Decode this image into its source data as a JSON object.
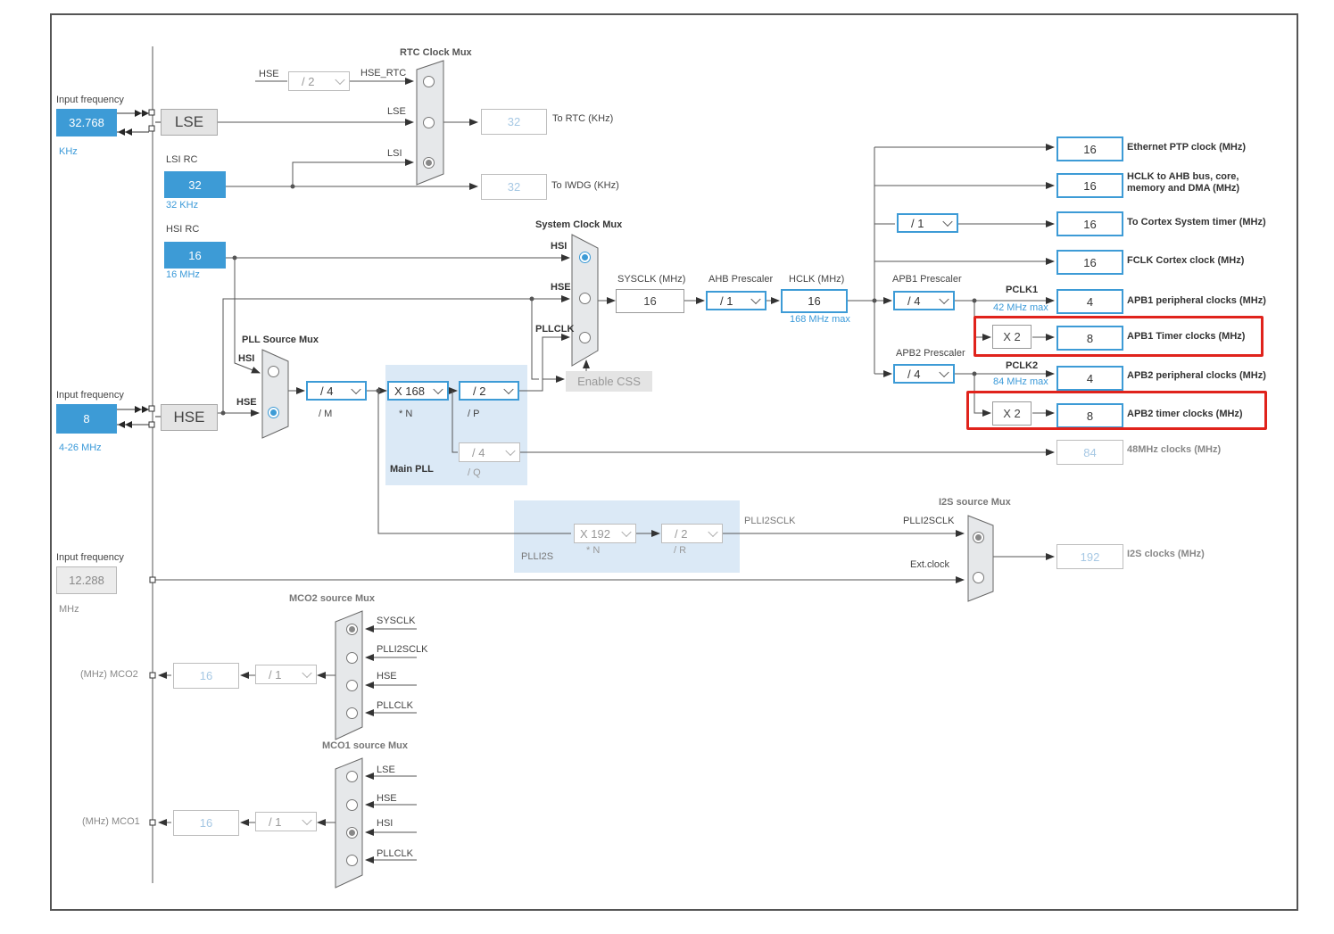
{
  "lse": {
    "input_label": "Input frequency",
    "value": "32.768",
    "unit": "KHz",
    "name": "LSE"
  },
  "lsi": {
    "label": "LSI RC",
    "value": "32",
    "unit": "32 KHz"
  },
  "hsi": {
    "label": "HSI RC",
    "value": "16",
    "unit": "16 MHz"
  },
  "hse": {
    "input_label": "Input frequency",
    "value": "8",
    "unit": "4-26 MHz",
    "name": "HSE"
  },
  "ext": {
    "input_label": "Input frequency",
    "value": "12.288",
    "unit": "MHz"
  },
  "rtc": {
    "mux_title": "RTC Clock Mux",
    "hse_label": "HSE",
    "div": "/ 2",
    "hse_rtc": "HSE_RTC",
    "lse": "LSE",
    "lsi": "LSI",
    "out_value": "32",
    "out_label": "To RTC (KHz)",
    "iwdg_value": "32",
    "iwdg_label": "To IWDG (KHz)"
  },
  "sysmux": {
    "title": "System Clock Mux",
    "hsi": "HSI",
    "hse": "HSE",
    "pllclk": "PLLCLK",
    "enable_css": "Enable CSS"
  },
  "pllmux": {
    "title": "PLL Source Mux",
    "hsi": "HSI",
    "hse": "HSE",
    "m_div": "/ 4",
    "m_label": "/ M"
  },
  "mainpll": {
    "n_mul": "X 168",
    "n_label": "* N",
    "p_div": "/ 2",
    "p_label": "/ P",
    "q_div": "/ 4",
    "q_label": "/ Q",
    "title": "Main PLL"
  },
  "sysclk": {
    "label": "SYSCLK (MHz)",
    "value": "16"
  },
  "ahb": {
    "label": "AHB Prescaler",
    "div": "/ 1"
  },
  "hclk": {
    "label": "HCLK (MHz)",
    "value": "16",
    "max": "168 MHz max"
  },
  "apb1": {
    "label": "APB1 Prescaler",
    "div": "/ 4",
    "pclk": "PCLK1",
    "max": "42 MHz max",
    "x2": "X 2"
  },
  "apb2": {
    "label": "APB2 Prescaler",
    "div": "/ 4",
    "pclk": "PCLK2",
    "max": "84 MHz max",
    "x2": "X 2"
  },
  "cortex_div": "/ 1",
  "outputs": [
    {
      "value": "16",
      "label": "Ethernet PTP clock (MHz)"
    },
    {
      "value": "16",
      "label": "HCLK to AHB bus, core, memory and DMA (MHz)"
    },
    {
      "value": "16",
      "label": "To Cortex System timer (MHz)"
    },
    {
      "value": "16",
      "label": "FCLK Cortex clock (MHz)"
    },
    {
      "value": "4",
      "label": "APB1 peripheral clocks (MHz)"
    },
    {
      "value": "8",
      "label": "APB1 Timer clocks (MHz)"
    },
    {
      "value": "4",
      "label": "APB2 peripheral clocks (MHz)"
    },
    {
      "value": "8",
      "label": "APB2 timer clocks (MHz)"
    },
    {
      "value": "84",
      "label": "48MHz clocks (MHz)"
    }
  ],
  "plli2s": {
    "n_mul": "X 192",
    "n_label": "* N",
    "r_div": "/ 2",
    "r_label": "/ R",
    "title": "PLLI2S",
    "clk_label": "PLLI2SCLK"
  },
  "i2s": {
    "title": "I2S source Mux",
    "in1": "PLLI2SCLK",
    "in2": "Ext.clock",
    "value": "192",
    "label": "I2S clocks (MHz)"
  },
  "mco2": {
    "mux_title": "MCO2 source Mux",
    "in": [
      "SYSCLK",
      "PLLI2SCLK",
      "HSE",
      "PLLCLK"
    ],
    "div": "/ 1",
    "value": "16",
    "label": "(MHz) MCO2"
  },
  "mco1": {
    "mux_title": "MCO1 source Mux",
    "in": [
      "LSE",
      "HSE",
      "HSI",
      "PLLCLK"
    ],
    "div": "/ 1",
    "value": "16",
    "label": "(MHz) MCO1"
  },
  "colors": {
    "accent": "#3d9bd6",
    "highlight": "#e0231c",
    "region": "#dbe9f6"
  }
}
